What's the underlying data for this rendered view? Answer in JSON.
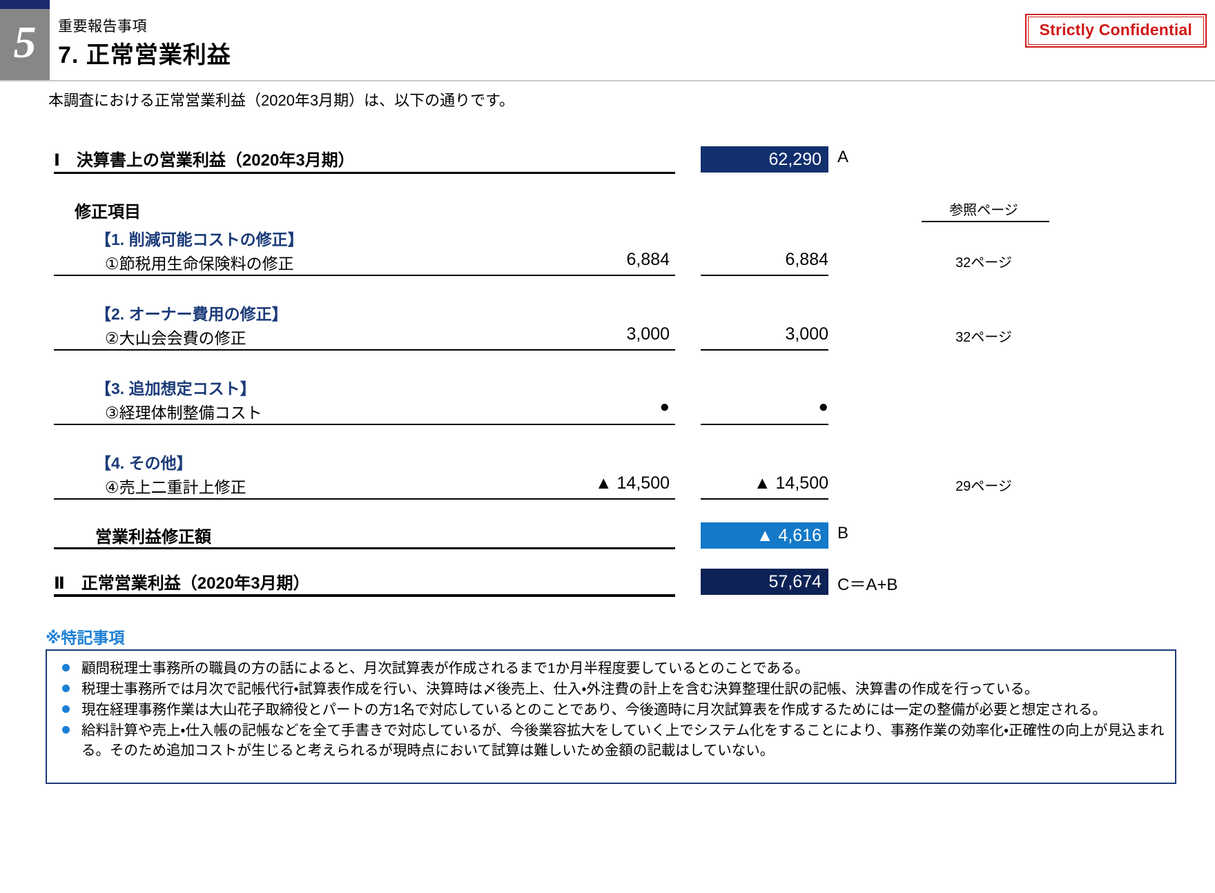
{
  "header": {
    "page_number": "5",
    "eyebrow": "重要報告事項",
    "title": "7. 正常営業利益",
    "confidential": "Strictly Confidential"
  },
  "lead": "本調査における正常営業利益（2020年3月期）は、以下の通りです。",
  "table": {
    "ref_header": "参照ページ",
    "row_I": {
      "label": "Ⅰ　決算書上の営業利益（2020年3月期）",
      "amount": "62,290",
      "suffix": "A"
    },
    "adjust_header": "修正項目",
    "sections": [
      {
        "heading": "【1. 削減可能コストの修正】",
        "item": "①節税用生命保険料の修正",
        "amount_left": "6,884",
        "amount_right": "6,884",
        "ref": "32ページ"
      },
      {
        "heading": "【2. オーナー費用の修正】",
        "item": "②大山会会費の修正",
        "amount_left": "3,000",
        "amount_right": "3,000",
        "ref": "32ページ"
      },
      {
        "heading": "【3. 追加想定コスト】",
        "item": "③経理体制整備コスト",
        "amount_left": "●",
        "amount_right": "●",
        "ref": ""
      },
      {
        "heading": "【4. その他】",
        "item": "④売上二重計上修正",
        "amount_left": "▲ 14,500",
        "amount_right": "▲ 14,500",
        "ref": "29ページ"
      }
    ],
    "row_B": {
      "label": "営業利益修正額",
      "amount": "▲ 4,616",
      "suffix": "B"
    },
    "row_II": {
      "label": "Ⅱ　正常営業利益（2020年3月期）",
      "amount": "57,674",
      "suffix": "C＝A+B"
    }
  },
  "notes": {
    "title": "※特記事項",
    "items": [
      "顧問税理士事務所の職員の方の話によると、月次試算表が作成されるまで1か月半程度要しているとのことである。",
      "税理士事務所では月次で記帳代行・試算表作成を行い、決算時は〆後売上、仕入・外注費の計上を含む決算整理仕訳の記帳、決算書の作成を行っている。",
      "現在経理事務作業は大山花子取締役とパートの方1名で対応しているとのことであり、今後適時に月次試算表を作成するためには一定の整備が必要と想定される。",
      "給料計算や売上・仕入帳の記帳などを全て手書きで対応しているが、今後業容拡大をしていく上でシステム化をすることにより、事務作業の効率化・正確性の向上が見込まれる。そのため追加コストが生じると考えられるが現時点において試算は難しいため金額の記載はしていない。"
    ]
  },
  "colors": {
    "navy": "#12306e",
    "navy_dark": "#0d2255",
    "blue": "#1479c8",
    "heading_blue": "#1b3a78",
    "note_blue": "#1b7fd4",
    "red": "#d01717",
    "gray": "#878787"
  }
}
